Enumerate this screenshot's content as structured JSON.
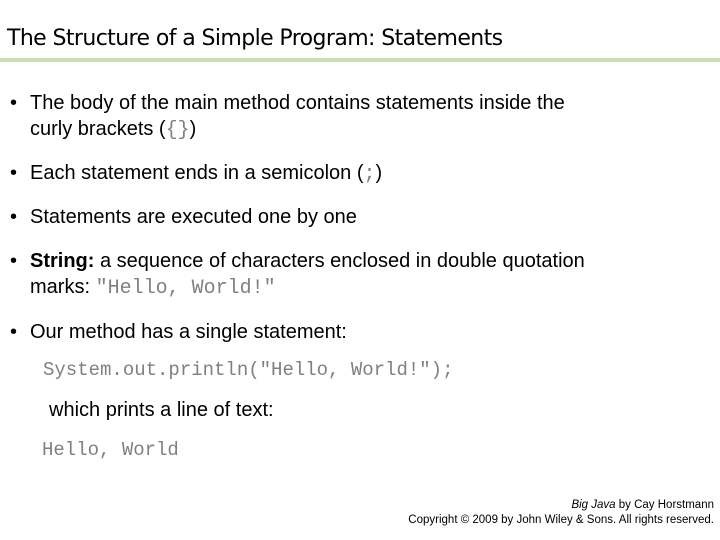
{
  "title": "The Structure of a Simple Program: Statements",
  "bullets": [
    {
      "line1": "The body of the main method contains statements inside the",
      "line2_text": "curly brackets (",
      "line2_code": "{}",
      "line2_end": ")"
    },
    {
      "text": "Each statement ends in a semicolon (",
      "code": ";",
      "end": ")"
    },
    {
      "text": "Statements are executed one by one"
    },
    {
      "bold": "String:",
      "line1": " a sequence of characters enclosed in double quotation",
      "line2_text": "marks: ",
      "line2_code": "\"Hello, World!\""
    },
    {
      "text": "Our method has a single statement:"
    }
  ],
  "code_statement": "System.out.println(\"Hello, World!\");",
  "prints_text": "which prints a line of text:",
  "output_text": "Hello, World",
  "footer": {
    "book": "Big Java",
    "by_author": " by Cay Horstmann",
    "copyright": "Copyright © 2009 by John Wiley & Sons.  All rights reserved."
  }
}
